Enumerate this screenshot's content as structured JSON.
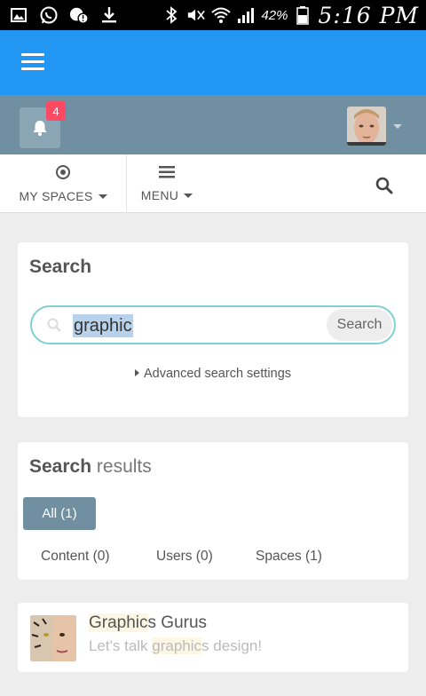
{
  "status_bar": {
    "battery_percent": "42%",
    "time": "5:16 PM",
    "icons": [
      "gallery-icon",
      "whatsapp-icon",
      "face-alert-icon",
      "download-icon",
      "bluetooth-icon",
      "mute-icon",
      "wifi-icon",
      "signal-icon",
      "battery-icon"
    ]
  },
  "topbar": {
    "menu_icon": "hamburger-icon",
    "color": "#2196f3"
  },
  "userbar": {
    "notification_count": "4",
    "color": "#708fa0"
  },
  "nav": {
    "spaces_label": "MY SPACES",
    "menu_label": "MENU"
  },
  "search": {
    "title": "Search",
    "query": "graphic",
    "button_label": "Search",
    "advanced_label": "Advanced search settings"
  },
  "results": {
    "title_bold": "Search",
    "title_light": "results",
    "tabs": [
      {
        "label": "All (1)",
        "active": true
      },
      {
        "label": "Content (0)"
      },
      {
        "label": "Users (0)"
      },
      {
        "label": "Spaces (1)"
      }
    ]
  },
  "item": {
    "title_match": "Graphic",
    "title_rest": "s Gurus",
    "desc_pre": "Let's talk ",
    "desc_match": "graphic",
    "desc_post": "s design!"
  }
}
